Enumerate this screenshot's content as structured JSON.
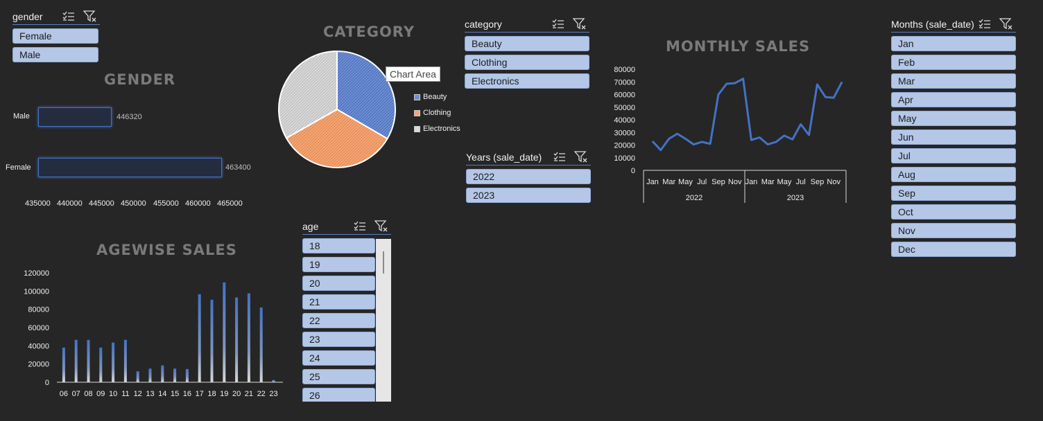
{
  "slicers": {
    "gender": {
      "title": "gender",
      "items": [
        "Female",
        "Male"
      ]
    },
    "category": {
      "title": "category",
      "items": [
        "Beauty",
        "Clothing",
        "Electronics"
      ]
    },
    "years": {
      "title": "Years (sale_date)",
      "items": [
        "2022",
        "2023"
      ]
    },
    "months": {
      "title": "Months (sale_date)",
      "items": [
        "Jan",
        "Feb",
        "Mar",
        "Apr",
        "May",
        "Jun",
        "Jul",
        "Aug",
        "Sep",
        "Oct",
        "Nov",
        "Dec"
      ]
    },
    "age": {
      "title": "age",
      "items": [
        "18",
        "19",
        "20",
        "21",
        "22",
        "23",
        "24",
        "25",
        "26"
      ]
    }
  },
  "icons": {
    "multi_select": "multi-select-icon",
    "clear_filter": "clear-filter-icon"
  },
  "tooltip": "Chart Area",
  "chart_data": [
    {
      "type": "bar",
      "orientation": "horizontal",
      "title": "GENDER",
      "categories": [
        "Male",
        "Female"
      ],
      "values": [
        446320,
        463400
      ],
      "data_labels": [
        "446320",
        "463400"
      ],
      "xlim": [
        435000,
        465000
      ],
      "xticks": [
        "435000",
        "440000",
        "445000",
        "450000",
        "455000",
        "460000",
        "465000"
      ],
      "grid": false
    },
    {
      "type": "pie",
      "title": "CATEGORY",
      "labels": [
        "Beauty",
        "Clothing",
        "Electronics"
      ],
      "values": [
        33.4,
        33.4,
        33.2
      ],
      "colors": [
        "#4472c4",
        "#ed7d31",
        "#a5a5a5"
      ],
      "legend": "right"
    },
    {
      "type": "line",
      "title": "MONTHLY SALES",
      "x": [
        "Jan",
        "Feb",
        "Mar",
        "Apr",
        "May",
        "Jun",
        "Jul",
        "Aug",
        "Sep",
        "Oct",
        "Nov",
        "Dec",
        "Jan",
        "Feb",
        "Mar",
        "Apr",
        "May",
        "Jun",
        "Jul",
        "Aug",
        "Sep",
        "Oct",
        "Nov",
        "Dec"
      ],
      "xtick_labels": [
        "Jan",
        "Mar",
        "May",
        "Jul",
        "Sep",
        "Nov",
        "Jan",
        "Mar",
        "May",
        "Jul",
        "Sep",
        "Nov"
      ],
      "groups": [
        "2022",
        "2023"
      ],
      "values": [
        23000,
        16000,
        25000,
        29000,
        25000,
        20500,
        22500,
        21000,
        60000,
        68500,
        69000,
        72500,
        24000,
        26000,
        20500,
        22500,
        27500,
        24500,
        36500,
        28000,
        68000,
        58000,
        57500,
        70000
      ],
      "ylim": [
        0,
        80000
      ],
      "yticks": [
        "80000",
        "70000",
        "60000",
        "50000",
        "40000",
        "30000",
        "20000",
        "10000",
        "0"
      ],
      "color": "#4472c4",
      "grid": false
    },
    {
      "type": "bar",
      "title": "AGEWISE SALES",
      "categories": [
        "06",
        "07",
        "08",
        "09",
        "10",
        "11",
        "12",
        "13",
        "14",
        "15",
        "16",
        "17",
        "18",
        "19",
        "20",
        "21",
        "22",
        "23"
      ],
      "values": [
        38000,
        46500,
        46500,
        38000,
        43500,
        46500,
        12000,
        15000,
        18500,
        15000,
        14500,
        96500,
        90500,
        109500,
        93000,
        97500,
        82000,
        2500
      ],
      "ylim": [
        0,
        120000
      ],
      "yticks": [
        "120000",
        "100000",
        "80000",
        "60000",
        "40000",
        "20000",
        "0"
      ],
      "grid": false
    }
  ]
}
